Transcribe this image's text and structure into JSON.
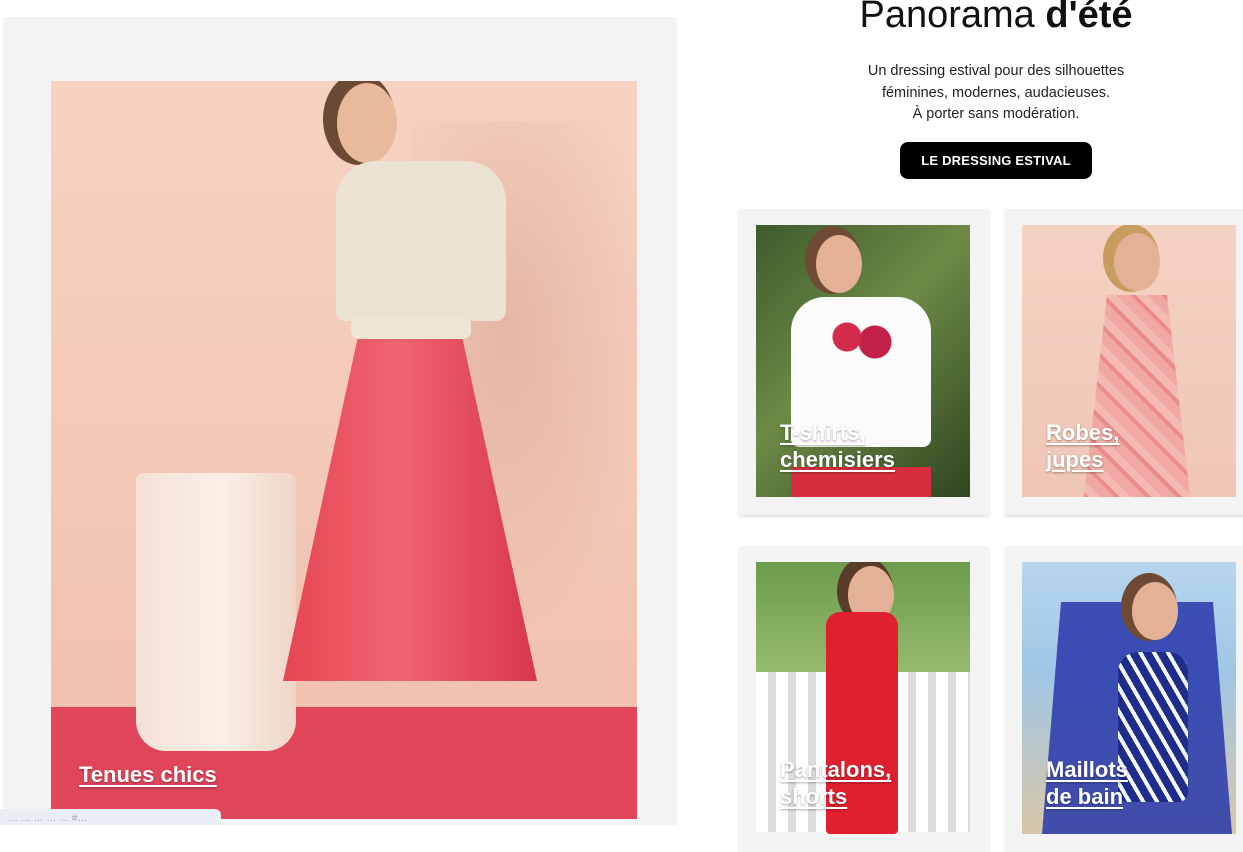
{
  "hero": {
    "link_label": "Tenues chics"
  },
  "bottom_chip": {
    "text": "… … … … … #…"
  },
  "promo": {
    "title_light": "Panorama ",
    "title_bold": "d'été",
    "description_lines": [
      "Un dressing estival pour des silhouettes",
      "féminines, modernes, audacieuses.",
      "À porter sans modération."
    ],
    "cta_label": "LE DRESSING ESTIVAL"
  },
  "categories": [
    {
      "line1": "T-shirts,",
      "line2": "chemisiers"
    },
    {
      "line1": "Robes,",
      "line2": "jupes"
    },
    {
      "line1": "Pantalons,",
      "line2": "shorts"
    },
    {
      "line1": "Maillots",
      "line2": "de bain"
    }
  ]
}
